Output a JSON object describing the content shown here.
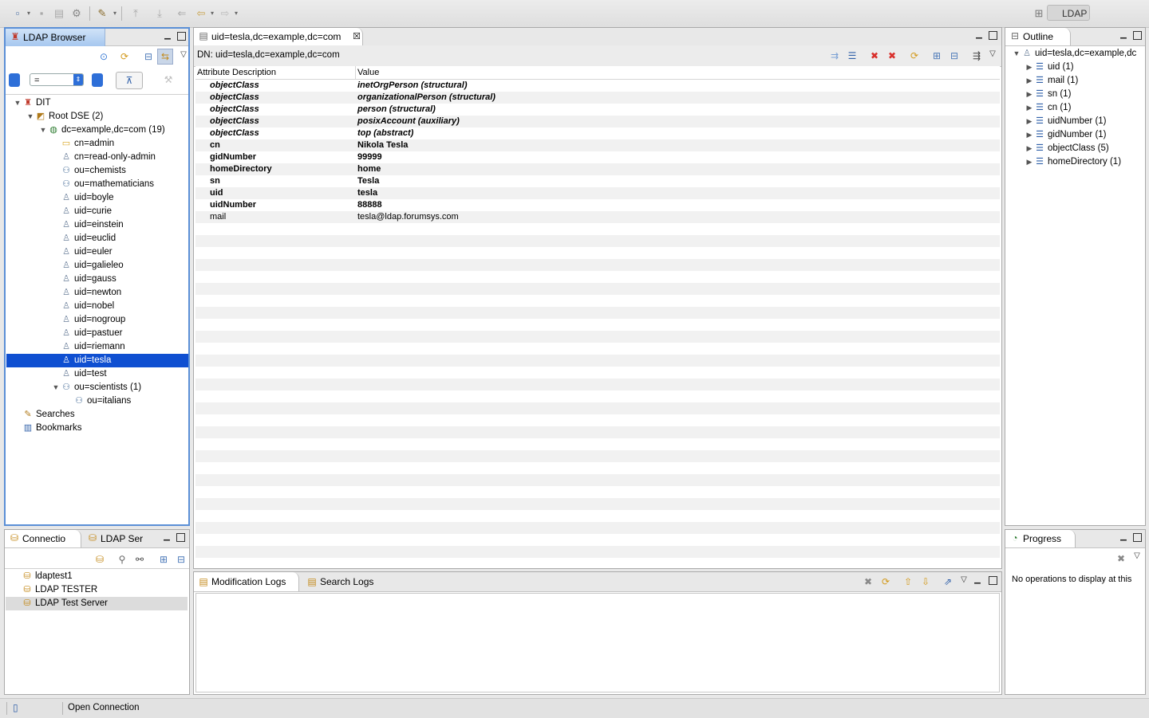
{
  "perspective": {
    "label": "LDAP"
  },
  "ldap_browser": {
    "title": "LDAP Browser",
    "filter_operator": "=",
    "tree": [
      {
        "label": "DIT",
        "level": 0,
        "twisty": "open",
        "icon": "dit-icon"
      },
      {
        "label": "Root DSE (2)",
        "level": 1,
        "twisty": "open",
        "icon": "root-dse-icon"
      },
      {
        "label": "dc=example,dc=com (19)",
        "level": 2,
        "twisty": "open",
        "icon": "globe-icon"
      },
      {
        "label": "cn=admin",
        "level": 3,
        "twisty": "none",
        "icon": "folder-icon"
      },
      {
        "label": "cn=read-only-admin",
        "level": 3,
        "twisty": "none",
        "icon": "person-icon"
      },
      {
        "label": "ou=chemists",
        "level": 3,
        "twisty": "none",
        "icon": "group-icon"
      },
      {
        "label": "ou=mathematicians",
        "level": 3,
        "twisty": "none",
        "icon": "group-icon"
      },
      {
        "label": "uid=boyle",
        "level": 3,
        "twisty": "none",
        "icon": "person-icon"
      },
      {
        "label": "uid=curie",
        "level": 3,
        "twisty": "none",
        "icon": "person-icon"
      },
      {
        "label": "uid=einstein",
        "level": 3,
        "twisty": "none",
        "icon": "person-icon"
      },
      {
        "label": "uid=euclid",
        "level": 3,
        "twisty": "none",
        "icon": "person-icon"
      },
      {
        "label": "uid=euler",
        "level": 3,
        "twisty": "none",
        "icon": "person-icon"
      },
      {
        "label": "uid=galieleo",
        "level": 3,
        "twisty": "none",
        "icon": "person-icon"
      },
      {
        "label": "uid=gauss",
        "level": 3,
        "twisty": "none",
        "icon": "person-icon"
      },
      {
        "label": "uid=newton",
        "level": 3,
        "twisty": "none",
        "icon": "person-icon"
      },
      {
        "label": "uid=nobel",
        "level": 3,
        "twisty": "none",
        "icon": "person-icon"
      },
      {
        "label": "uid=nogroup",
        "level": 3,
        "twisty": "none",
        "icon": "person-icon"
      },
      {
        "label": "uid=pastuer",
        "level": 3,
        "twisty": "none",
        "icon": "person-icon"
      },
      {
        "label": "uid=riemann",
        "level": 3,
        "twisty": "none",
        "icon": "person-icon"
      },
      {
        "label": "uid=tesla",
        "level": 3,
        "twisty": "none",
        "icon": "person-icon",
        "selected": true
      },
      {
        "label": "uid=test",
        "level": 3,
        "twisty": "none",
        "icon": "person-icon"
      },
      {
        "label": "ou=scientists (1)",
        "level": 3,
        "twisty": "open",
        "icon": "group-icon"
      },
      {
        "label": "ou=italians",
        "level": 4,
        "twisty": "none",
        "icon": "group-icon"
      },
      {
        "label": "Searches",
        "level": 0,
        "twisty": "none",
        "icon": "searches-icon"
      },
      {
        "label": "Bookmarks",
        "level": 0,
        "twisty": "none",
        "icon": "bookmarks-icon"
      }
    ]
  },
  "connections": {
    "tabs": [
      "Connectio",
      "LDAP Ser"
    ],
    "items": [
      "ldaptest1",
      "LDAP TESTER",
      "LDAP Test Server"
    ],
    "selected_index": 2
  },
  "editor": {
    "tab_title": "uid=tesla,dc=example,dc=com",
    "dn": "DN: uid=tesla,dc=example,dc=com",
    "columns": [
      "Attribute Description",
      "Value"
    ],
    "rows": [
      {
        "attr": "objectClass",
        "value": "inetOrgPerson (structural)",
        "style": "bi"
      },
      {
        "attr": "objectClass",
        "value": "organizationalPerson (structural)",
        "style": "bi"
      },
      {
        "attr": "objectClass",
        "value": "person (structural)",
        "style": "bi"
      },
      {
        "attr": "objectClass",
        "value": "posixAccount (auxiliary)",
        "style": "bi"
      },
      {
        "attr": "objectClass",
        "value": "top (abstract)",
        "style": "bi"
      },
      {
        "attr": "cn",
        "value": "Nikola Tesla",
        "style": "b"
      },
      {
        "attr": "gidNumber",
        "value": "99999",
        "style": "b"
      },
      {
        "attr": "homeDirectory",
        "value": "home",
        "style": "b"
      },
      {
        "attr": "sn",
        "value": "Tesla",
        "style": "b"
      },
      {
        "attr": "uid",
        "value": "tesla",
        "style": "b"
      },
      {
        "attr": "uidNumber",
        "value": "88888",
        "style": "b"
      },
      {
        "attr": "mail",
        "value": "tesla@ldap.forumsys.com",
        "style": "n"
      }
    ]
  },
  "outline": {
    "title": "Outline",
    "root": "uid=tesla,dc=example,dc",
    "items": [
      "uid (1)",
      "mail (1)",
      "sn (1)",
      "cn (1)",
      "uidNumber (1)",
      "gidNumber (1)",
      "objectClass (5)",
      "homeDirectory (1)"
    ]
  },
  "logs": {
    "tabs": [
      "Modification Logs",
      "Search Logs"
    ]
  },
  "progress": {
    "title": "Progress",
    "message": "No operations to display at this"
  },
  "status_bar": {
    "text": "Open Connection"
  }
}
